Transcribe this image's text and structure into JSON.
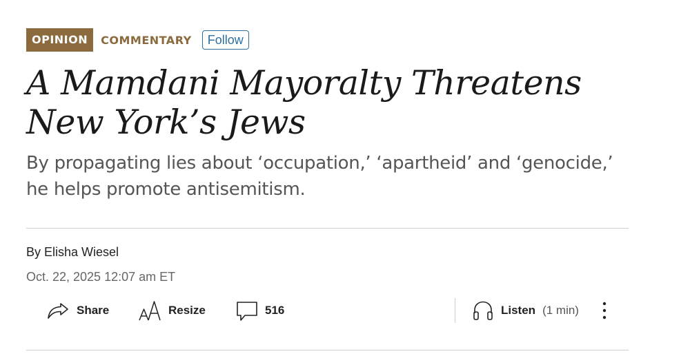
{
  "kicker": {
    "section": "OPINION",
    "category": "COMMENTARY",
    "follow_label": "Follow"
  },
  "article": {
    "headline": "A Mamdani Mayoralty Threatens New York’s Jews",
    "dek": "By propagating lies about ‘occupation,’ ‘apartheid’ and ‘genocide,’ he helps promote antisemitism.",
    "byline_prefix": "By ",
    "author": "Elisha Wiesel",
    "date": "Oct. 22, 2025 12:07 am ET"
  },
  "toolbar": {
    "share_label": "Share",
    "resize_label": "Resize",
    "comment_count": "516",
    "listen_label": "Listen",
    "listen_duration": "(1 min)"
  },
  "icons": {
    "share": "share-arrow-icon",
    "resize": "text-resize-icon",
    "comments": "speech-bubble-icon",
    "listen": "headphones-icon",
    "more": "vertical-ellipsis-icon"
  },
  "colors": {
    "opinion_badge": "#8b6a3e",
    "follow_accent": "#2a6f9f",
    "headline": "#1a1a1a",
    "dek": "#555555",
    "meta": "#666666",
    "rule": "#cfcfcf"
  }
}
